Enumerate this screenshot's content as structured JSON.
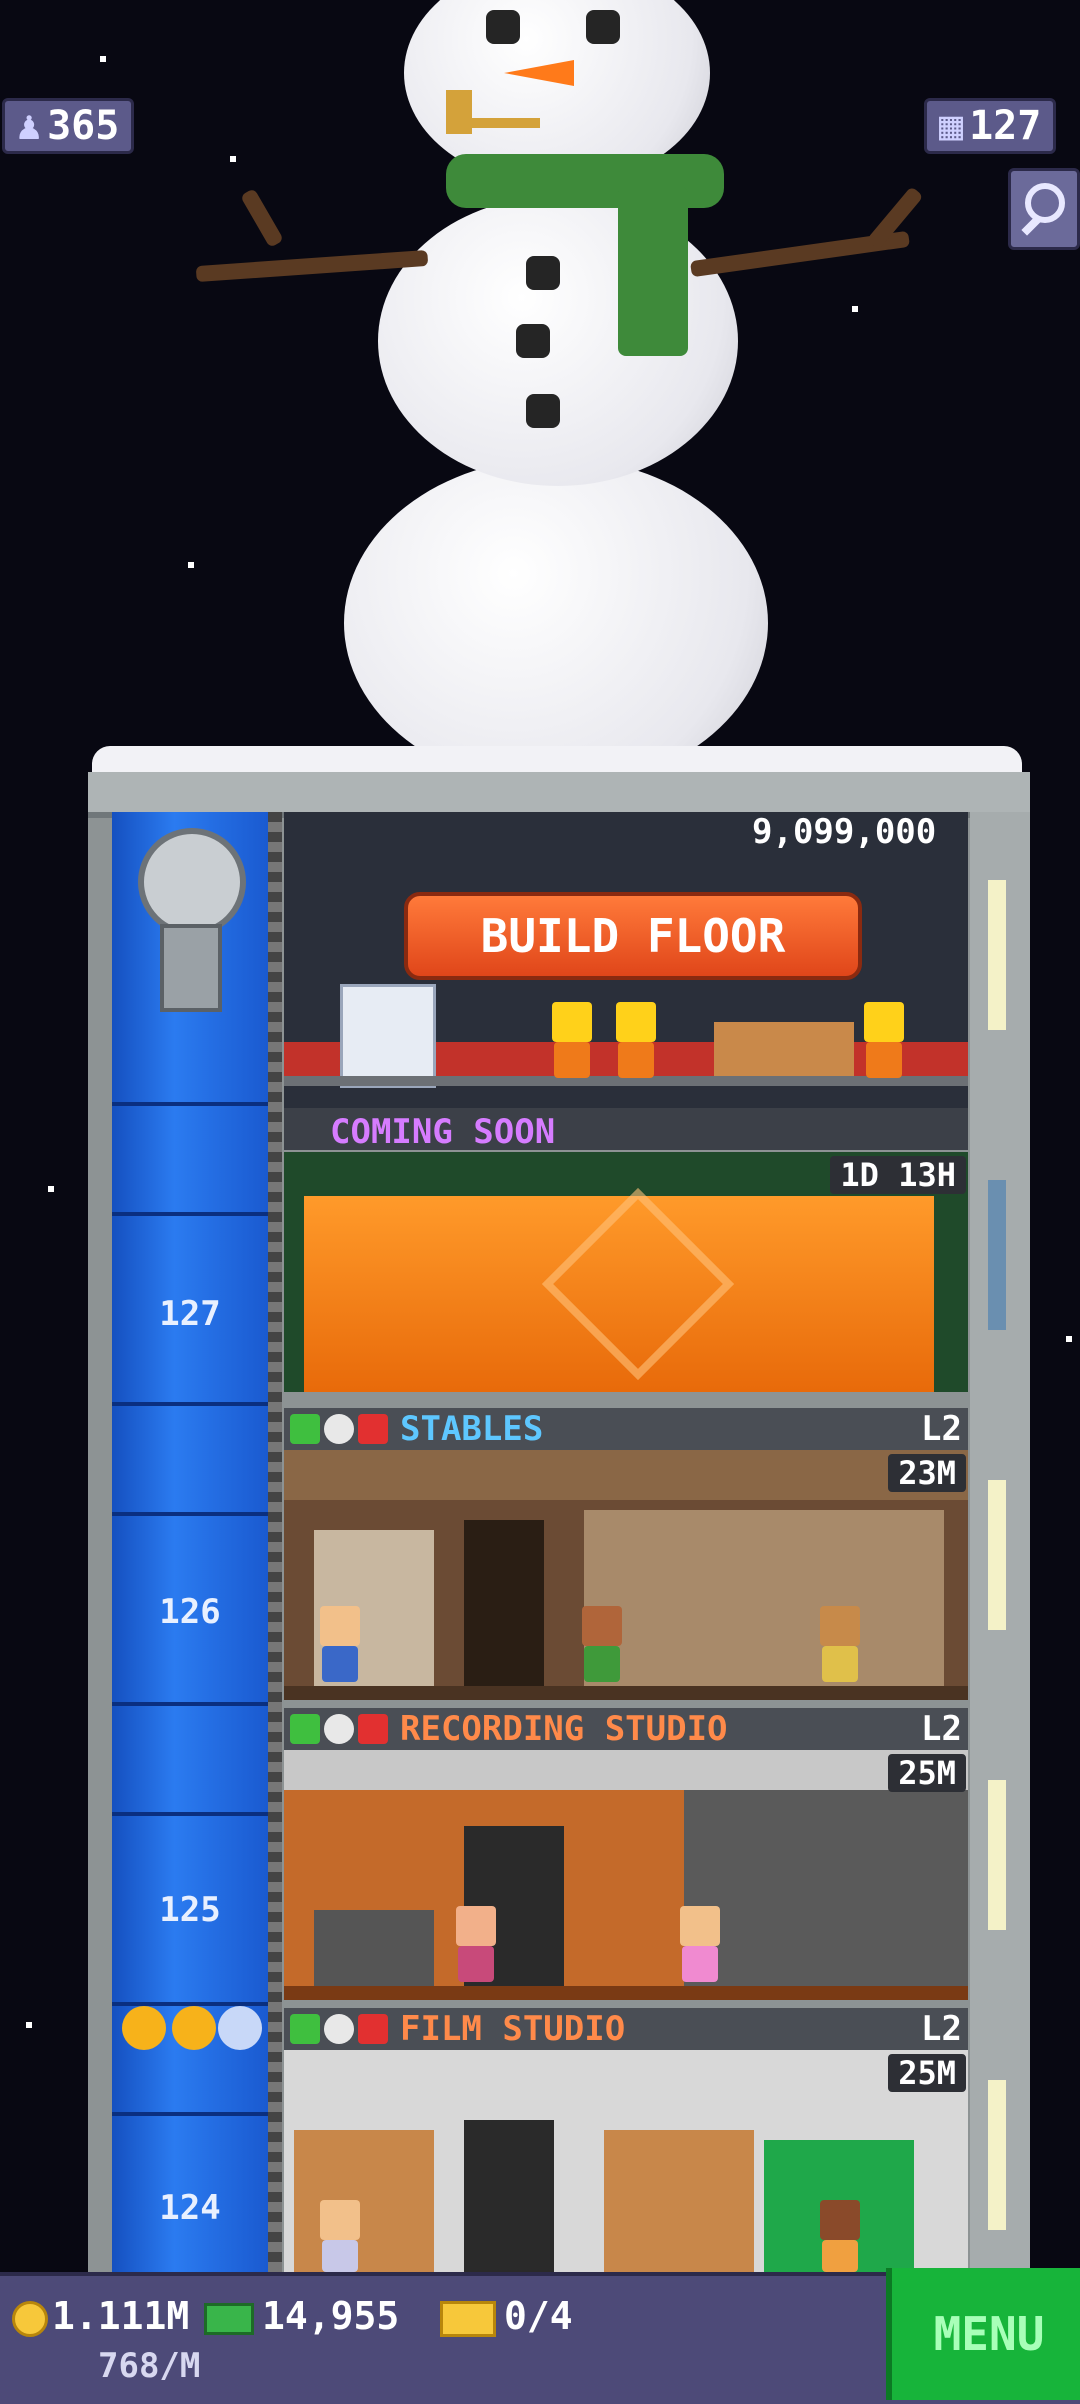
{
  "top_left": {
    "population": "365",
    "icon": "person-icon"
  },
  "top_right": {
    "floors": "127",
    "icon": "building-icon"
  },
  "tower": {
    "build_price": "9,099,000",
    "build_label": "BUILD FLOOR",
    "coming_soon": "COMING SOON",
    "construction_timer": "1D 13H",
    "floor_numbers": [
      "127",
      "126",
      "125",
      "124"
    ],
    "floors": [
      {
        "name": "STABLES",
        "level": "L2",
        "timer": "23M"
      },
      {
        "name": "RECORDING STUDIO",
        "level": "L2",
        "timer": "25M"
      },
      {
        "name": "FILM STUDIO",
        "level": "L2",
        "timer": "25M"
      }
    ]
  },
  "bottom_bar": {
    "coins": "1.111M",
    "coins_rate": "768/M",
    "bux": "14,955",
    "tickets": "0/4",
    "menu_label": "MENU"
  },
  "colors": {
    "accent_build": "#e0461a",
    "coming_soon": "#d67cff",
    "floor_name": "#5ec7ff",
    "menu": "#17b43a"
  }
}
